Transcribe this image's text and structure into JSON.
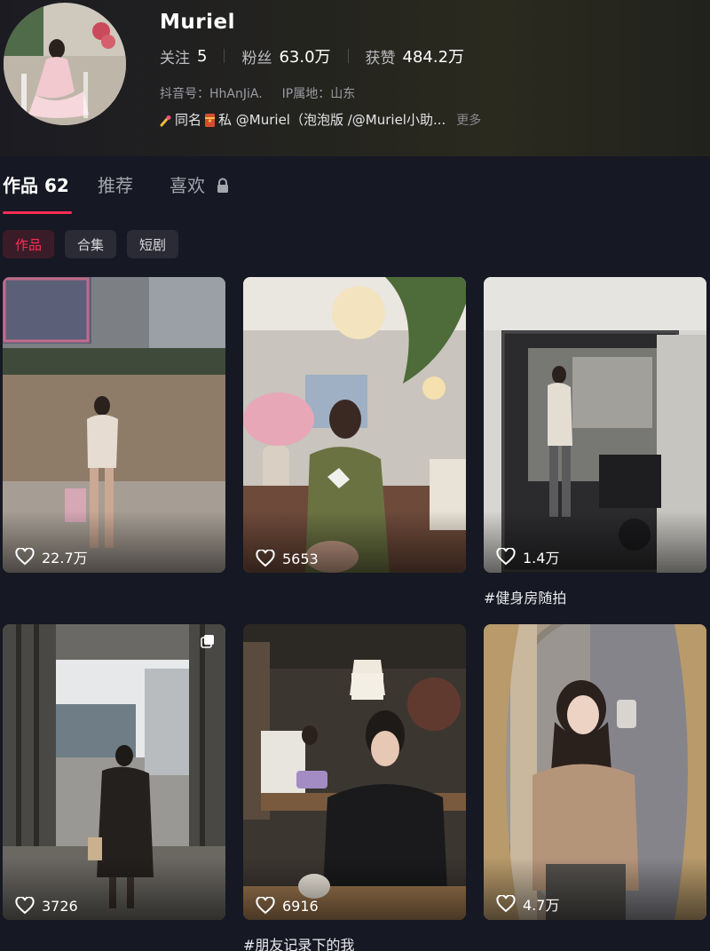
{
  "profile": {
    "username": "Muriel",
    "stats": [
      {
        "label": "关注",
        "value": "5"
      },
      {
        "label": "粉丝",
        "value": "63.0万"
      },
      {
        "label": "获赞",
        "value": "484.2万"
      }
    ],
    "douyin_id": "抖音号：HhAnJiA.",
    "ip_location": "IP属地：山东",
    "bio": "同名",
    "bio_private": "私 @Muriel（泡泡版 /@Muriel小助...",
    "more": "更多"
  },
  "tabs": {
    "works_label": "作品",
    "works_count": "62",
    "recommend_label": "推荐",
    "likes_label": "喜欢"
  },
  "filters": [
    "作品",
    "合集",
    "短剧"
  ],
  "videos": [
    {
      "likes": "22.7万",
      "caption": ""
    },
    {
      "likes": "5653",
      "caption": ""
    },
    {
      "likes": "1.4万",
      "caption": "#健身房随拍"
    },
    {
      "likes": "3726",
      "caption": ""
    },
    {
      "likes": "6916",
      "caption": "#朋友记录下的我"
    },
    {
      "likes": "4.7万",
      "caption": ""
    }
  ],
  "colors": {
    "accent": "#fe2c55",
    "background": "#161823"
  }
}
